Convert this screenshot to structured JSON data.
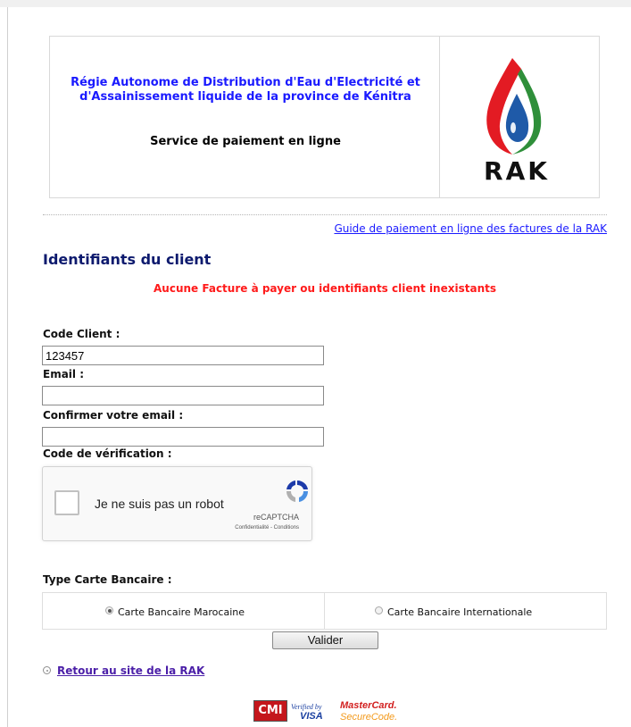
{
  "header": {
    "org_name": "Régie Autonome de Distribution d'Eau d'Electricité et d'Assainissement liquide de la province de Kénitra",
    "service_title": "Service de paiement en ligne",
    "logo_text": "RAK"
  },
  "guide_link": "Guide de paiement en ligne des factures de la RAK",
  "section_title": "Identifiants du client",
  "error_message": "Aucune Facture à payer ou identifiants client inexistants",
  "form": {
    "code_client_label": "Code Client :",
    "code_client_value": "123457",
    "email_label": "Email :",
    "email_value": "",
    "confirm_email_label": "Confirmer votre email :",
    "confirm_email_value": "",
    "verification_label": "Code de vérification :"
  },
  "recaptcha": {
    "label": "Je ne suis pas un robot",
    "brand": "reCAPTCHA",
    "terms": "Confidentialité - Conditions"
  },
  "card_type": {
    "label": "Type Carte Bancaire :",
    "options": [
      {
        "label": "Carte Bancaire Marocaine",
        "selected": true
      },
      {
        "label": "Carte Bancaire Internationale",
        "selected": false
      }
    ]
  },
  "validate_button": "Valider",
  "back_link": "Retour au site de la RAK",
  "payment_logos": {
    "cmi": "CMI",
    "verified_by": "Verified by",
    "visa": "VISA",
    "mastercard": "MasterCard.",
    "securecode": "SecureCode."
  },
  "icons": [
    "rak-logo-icon",
    "recaptcha-icon",
    "radio-bullet-icon"
  ]
}
